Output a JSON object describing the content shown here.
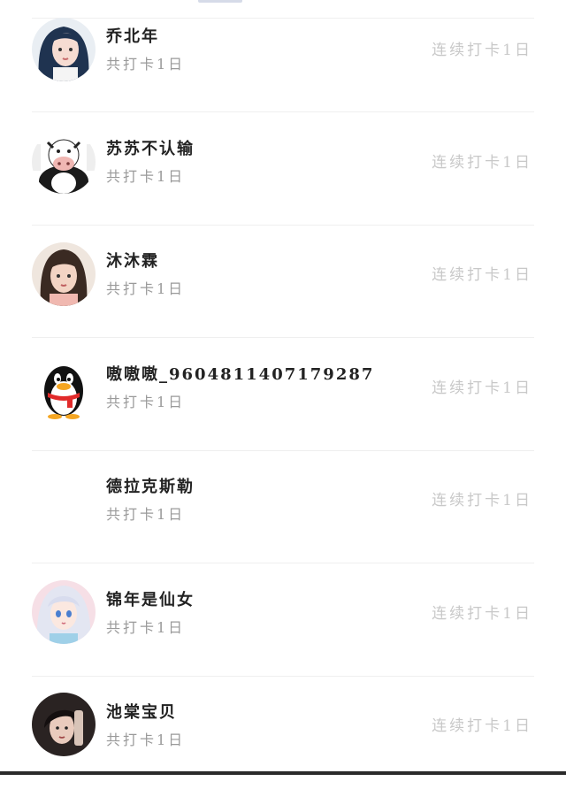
{
  "members": [
    {
      "name": "乔北年",
      "total": "共打卡1日",
      "streak": "连续打卡1日",
      "avatar": "girl-dark-blue-hair-avatar"
    },
    {
      "name": "苏苏不认输",
      "total": "共打卡1日",
      "streak": "连续打卡1日",
      "avatar": "cow-costume-avatar"
    },
    {
      "name": "沐沐霖",
      "total": "共打卡1日",
      "streak": "连续打卡1日",
      "avatar": "girl-portrait-avatar"
    },
    {
      "name": "嗷嗷嗷_9604811407179287",
      "total": "共打卡1日",
      "streak": "连续打卡1日",
      "avatar": "qq-penguin-avatar"
    },
    {
      "name": "德拉克斯勒",
      "total": "共打卡1日",
      "streak": "连续打卡1日",
      "avatar": "blank-avatar"
    },
    {
      "name": "锦年是仙女",
      "total": "共打卡1日",
      "streak": "连续打卡1日",
      "avatar": "anime-girl-avatar"
    },
    {
      "name": "池棠宝贝",
      "total": "共打卡1日",
      "streak": "连续打卡1日",
      "avatar": "girl-dark-hair-avatar"
    }
  ],
  "colors": {
    "name_text": "#222222",
    "sub_text": "#9a9a9a",
    "streak_text": "#c8c8c8",
    "divider": "#efefef",
    "background": "#ffffff"
  }
}
